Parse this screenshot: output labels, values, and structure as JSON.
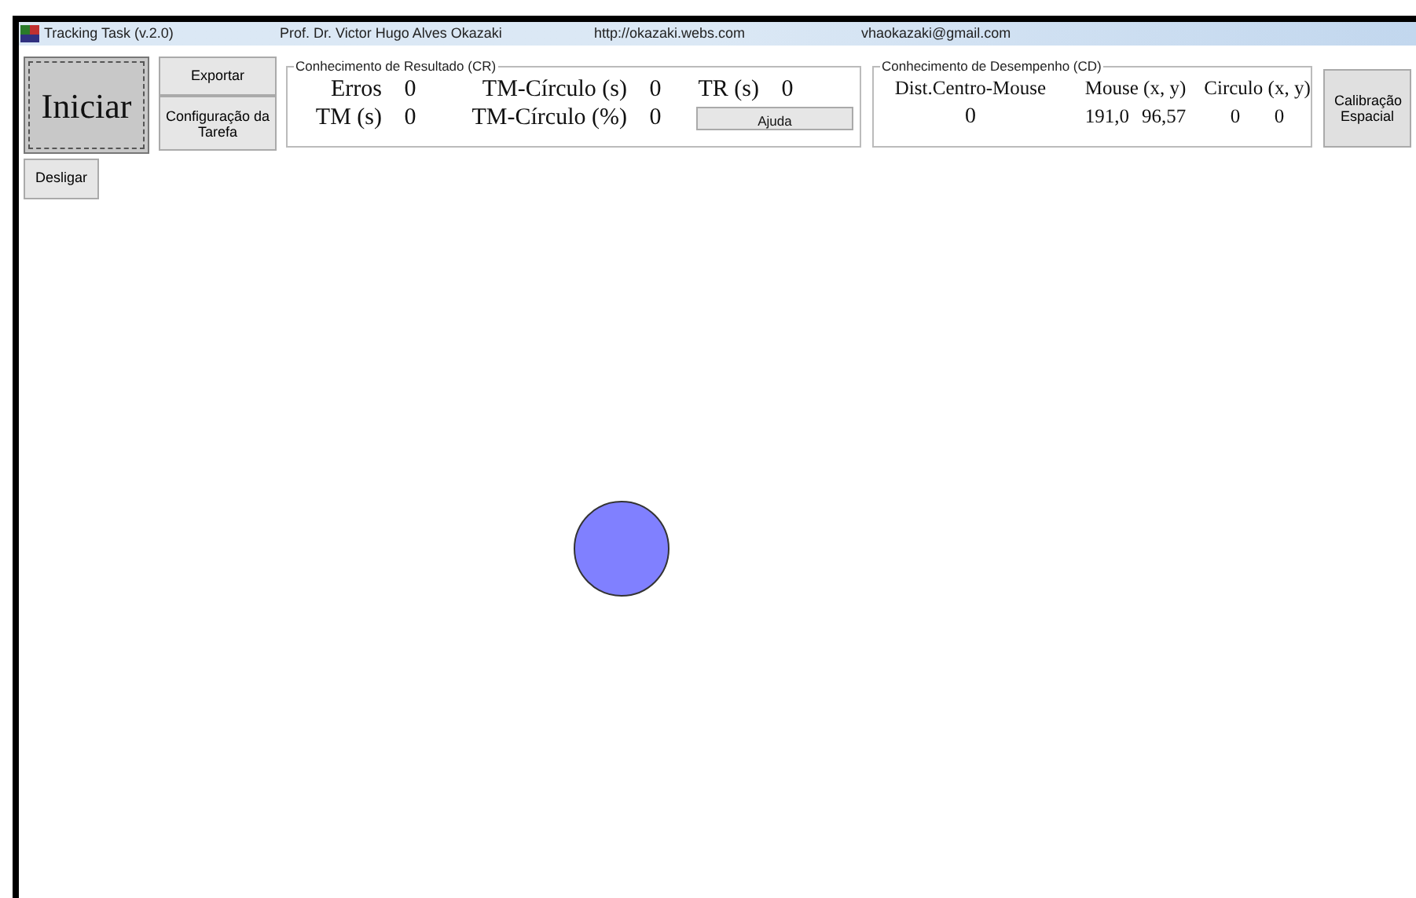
{
  "window": {
    "title_items": [
      "Tracking Task (v.2.0)",
      "Prof. Dr. Victor Hugo Alves Okazaki",
      "http://okazaki.webs.com",
      "vhaokazaki@gmail.com"
    ]
  },
  "buttons": {
    "start": "Iniciar",
    "export": "Exportar",
    "config": "Configuração da Tarefa",
    "off": "Desligar",
    "calibration": "Calibração Espacial",
    "help": "Ajuda"
  },
  "result_group": {
    "title": "Conhecimento de Resultado (CR)",
    "rows": [
      [
        {
          "label": "Erros",
          "value": "0"
        },
        {
          "label": "TM-Círculo (s)",
          "value": "0"
        },
        {
          "label": "TR (s)",
          "value": "0"
        }
      ],
      [
        {
          "label": "TM (s)",
          "value": "0"
        },
        {
          "label": "TM-Círculo (%)",
          "value": "0"
        }
      ]
    ]
  },
  "performance_group": {
    "title": "Conhecimento de Desempenho (CD)",
    "columns": [
      {
        "label": "Dist.Centro-Mouse",
        "values": [
          "0"
        ]
      },
      {
        "label": "Mouse (x, y)",
        "values": [
          "191,0",
          "96,57"
        ]
      },
      {
        "label": "Circulo (x, y)",
        "values": [
          "0",
          "0"
        ]
      }
    ]
  },
  "canvas": {
    "target": {
      "color": "#8080ff"
    }
  }
}
